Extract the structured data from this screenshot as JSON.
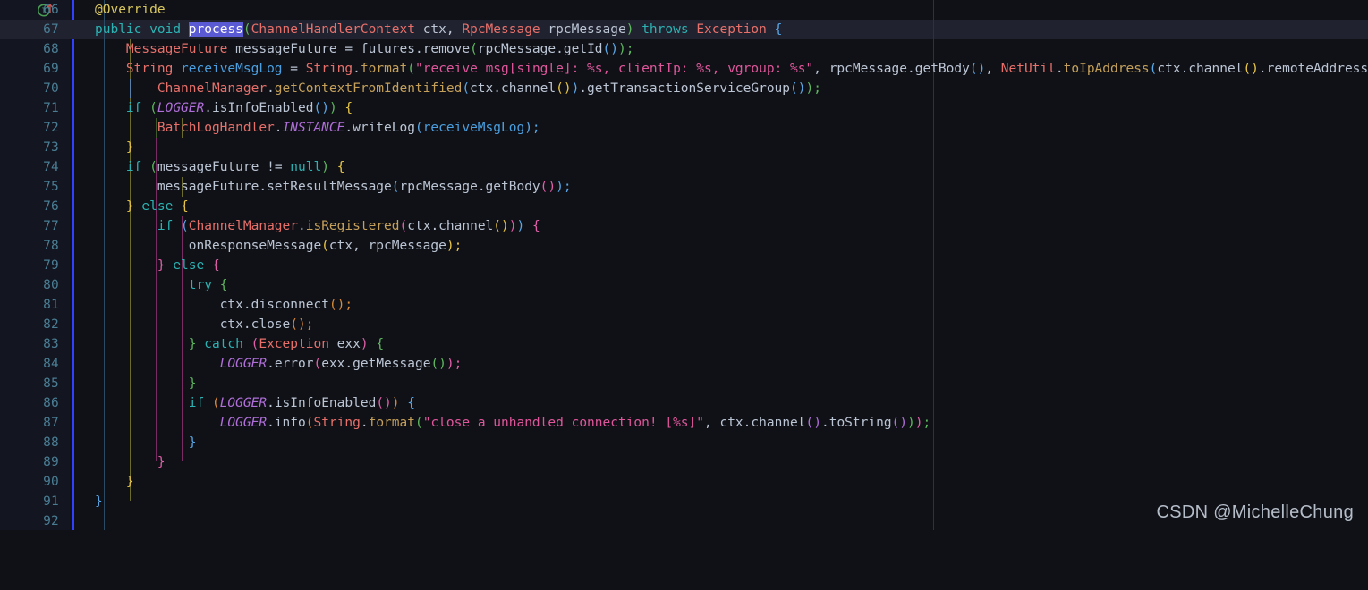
{
  "editor": {
    "theme": "darcula",
    "language": "java",
    "first_line": 66,
    "last_line": 92,
    "current_line": 67,
    "selected_token": "process",
    "colors": {
      "background": "#0f1117",
      "gutter_background": "#131620",
      "current_line_highlight": "#21222f",
      "line_number": "#4a7d94",
      "selection": "#5a5ad4",
      "gutter_separator": "#2f40ff",
      "right_margin_ruler": "#2b3245",
      "keyword": "#2bb3b3",
      "type": "#e8706a",
      "method": "#c5a05a",
      "variable": "#4a9fe0",
      "string": "#e0569b",
      "annotation": "#d9c760",
      "static_final": "#b06fd8",
      "default_text": "#bcc5d4"
    },
    "gutter_icon": {
      "line": 67,
      "name": "implementing-method-icon",
      "glyph": "I",
      "circle_color": "#499c54",
      "arrow_color": "#c75450"
    }
  },
  "line_numbers": [
    66,
    67,
    68,
    69,
    70,
    71,
    72,
    73,
    74,
    75,
    76,
    77,
    78,
    79,
    80,
    81,
    82,
    83,
    84,
    85,
    86,
    87,
    88,
    89,
    90,
    91,
    92
  ],
  "code_lines": [
    "    @Override",
    "    public void process(ChannelHandlerContext ctx, RpcMessage rpcMessage) throws Exception {",
    "        MessageFuture messageFuture = futures.remove(rpcMessage.getId());",
    "        String receiveMsgLog = String.format(\"receive msg[single]: %s, clientIp: %s, vgroup: %s\", rpcMessage.getBody(), NetUtil.toIpAddress(ctx.channel().remoteAddress()),",
    "                ChannelManager.getContextFromIdentified(ctx.channel()).getTransactionServiceGroup());",
    "        if (LOGGER.isInfoEnabled()) {",
    "            BatchLogHandler.INSTANCE.writeLog(receiveMsgLog);",
    "        }",
    "        if (messageFuture != null) {",
    "            messageFuture.setResultMessage(rpcMessage.getBody());",
    "        } else {",
    "            if (ChannelManager.isRegistered(ctx.channel())) {",
    "                onResponseMessage(ctx, rpcMessage);",
    "            } else {",
    "                try {",
    "                    ctx.disconnect();",
    "                    ctx.close();",
    "                } catch (Exception exx) {",
    "                    LOGGER.error(exx.getMessage());",
    "                }",
    "                if (LOGGER.isInfoEnabled()) {",
    "                    LOGGER.info(String.format(\"close a unhandled connection! [%s]\", ctx.channel().toString()));",
    "                }",
    "            }",
    "        }",
    "    }",
    ""
  ],
  "watermark": {
    "text": "CSDN @MichelleChung"
  }
}
